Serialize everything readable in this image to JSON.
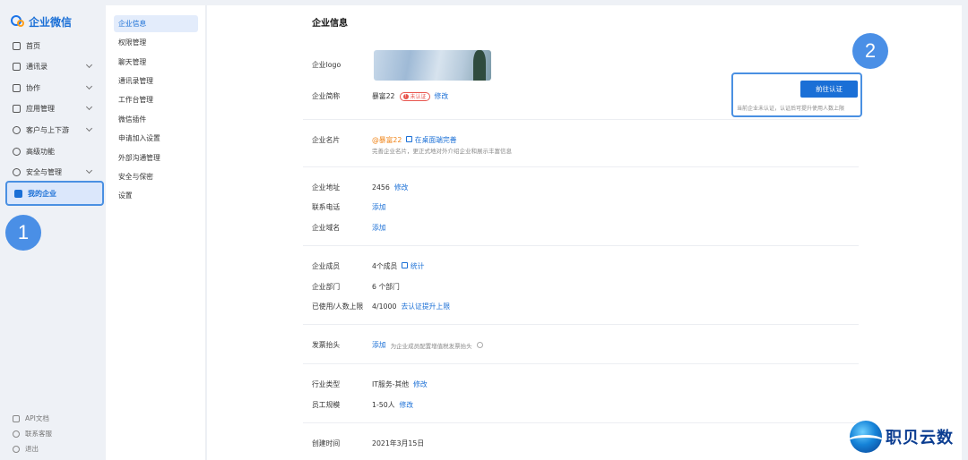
{
  "app": {
    "name": "企业微信"
  },
  "leftnav": {
    "items": [
      {
        "label": "首页",
        "icon": "home-icon"
      },
      {
        "label": "通讯录",
        "icon": "contacts-icon"
      },
      {
        "label": "协作",
        "icon": "collab-icon"
      },
      {
        "label": "应用管理",
        "icon": "apps-icon"
      },
      {
        "label": "客户与上下游",
        "icon": "customer-icon"
      },
      {
        "label": "高级功能",
        "icon": "advanced-icon"
      },
      {
        "label": "安全与管理",
        "icon": "security-icon"
      },
      {
        "label": "我的企业",
        "icon": "company-icon"
      }
    ],
    "footer": [
      {
        "label": "API文档"
      },
      {
        "label": "联系客服"
      },
      {
        "label": "退出"
      }
    ]
  },
  "markers": {
    "one": "1",
    "two": "2"
  },
  "subnav": {
    "items": [
      "企业信息",
      "权限管理",
      "聊天管理",
      "通讯录管理",
      "工作台管理",
      "微信插件",
      "申请加入设置",
      "外部沟通管理",
      "安全与保密",
      "设置"
    ]
  },
  "main": {
    "title": "企业信息",
    "logo_label": "企业logo",
    "short_name_label": "企业简称",
    "short_name_value": "暴富22",
    "unverified_tag": "未认证",
    "edit": "修改",
    "cert_button": "前往认证",
    "cert_tip": "当前企业未认证，认证后可提升使用人数上限",
    "card_label": "企业名片",
    "card_name": "@暴富22",
    "card_link": "在桌面端完善",
    "card_desc": "完善企业名片，更正式地对外介绍企业和展示丰富信息",
    "address_label": "企业地址",
    "address_value": "2456",
    "phone_label": "联系电话",
    "domain_label": "企业域名",
    "add": "添加",
    "members_label": "企业成员",
    "members_value": "4个成员",
    "stats": "统计",
    "dept_label": "企业部门",
    "dept_value": "6 个部门",
    "limit_label": "已使用/人数上限",
    "limit_value": "4/1000",
    "limit_link": "去认证提升上限",
    "invoice_label": "发票抬头",
    "invoice_desc": "为企业成员配置增值税发票抬头",
    "industry_label": "行业类型",
    "industry_value": "IT服务-其他",
    "size_label": "员工规模",
    "size_value": "1-50人",
    "created_label": "创建时间",
    "created_value": "2021年3月15日"
  },
  "brand": {
    "name": "职贝云数"
  }
}
